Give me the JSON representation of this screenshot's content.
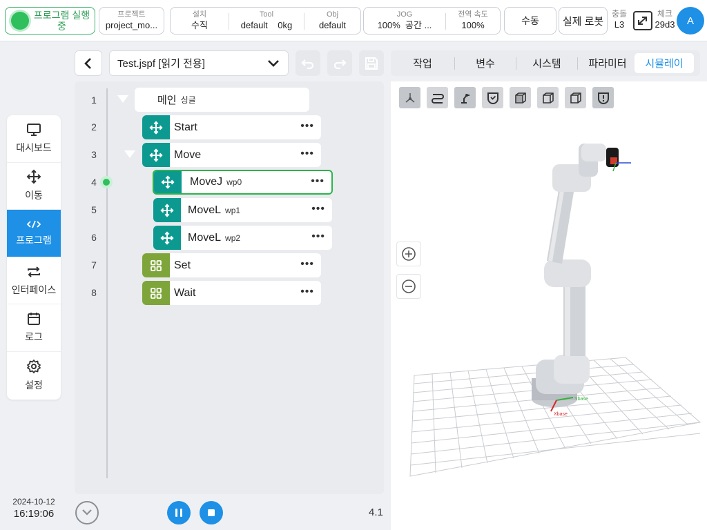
{
  "topbar": {
    "run_status": "프로그램 실행 중",
    "project": {
      "caption": "프로젝트",
      "value": "project_mo..."
    },
    "install": {
      "caption": "설치",
      "value": "수직"
    },
    "tool": {
      "caption": "Tool",
      "name": "default",
      "payload": "0kg"
    },
    "obj": {
      "caption": "Obj",
      "value": "default"
    },
    "jog": {
      "caption": "JOG",
      "speed": "100%",
      "frame": "공간 ..."
    },
    "global_speed": {
      "caption": "전역 속도",
      "value": "100%"
    },
    "mode_button": "수동",
    "robot_button": "실제 로봇",
    "collision": {
      "caption": "충돌",
      "value": "L3"
    },
    "check": {
      "caption": "체크",
      "value": "29d3"
    },
    "avatar": "A"
  },
  "nav": {
    "items": [
      {
        "label": "대시보드",
        "icon": "monitor-icon"
      },
      {
        "label": "이동",
        "icon": "move-icon"
      },
      {
        "label": "프로그램",
        "icon": "code-icon"
      },
      {
        "label": "인터페이스",
        "icon": "swap-icon"
      },
      {
        "label": "로그",
        "icon": "calendar-icon"
      },
      {
        "label": "설정",
        "icon": "gear-icon"
      }
    ],
    "active": 2
  },
  "datetime": {
    "date": "2024-10-12",
    "time": "16:19:06"
  },
  "program": {
    "file": "Test.jspf [읽기 전용]",
    "tree": [
      {
        "line": "1",
        "label": "메인",
        "sub": "싱글"
      },
      {
        "line": "2",
        "label": "Start",
        "sub": ""
      },
      {
        "line": "3",
        "label": "Move",
        "sub": ""
      },
      {
        "line": "4",
        "label": "MoveJ",
        "sub": "wp0"
      },
      {
        "line": "5",
        "label": "MoveL",
        "sub": "wp1"
      },
      {
        "line": "6",
        "label": "MoveL",
        "sub": "wp2"
      },
      {
        "line": "7",
        "label": "Set",
        "sub": ""
      },
      {
        "line": "8",
        "label": "Wait",
        "sub": ""
      }
    ],
    "current_line": "4",
    "version": "4.1"
  },
  "tabs": [
    "작업",
    "변수",
    "시스템",
    "파라미터",
    "시뮬레이"
  ],
  "active_tab": 4,
  "simulation": {
    "axis_labels": {
      "x": "Xbase",
      "y": "Ybase"
    },
    "toolbar_icons": [
      "axis-view-icon",
      "path-icon",
      "robot-arm-icon",
      "shield-check-icon",
      "cube-front-icon",
      "cube-side-icon",
      "cube-top-icon",
      "shield-alert-icon"
    ]
  },
  "colors": {
    "accent": "#1e90e6",
    "running": "#2fbf5c",
    "move_node": "#0c9a90",
    "io_node": "#7ea53a"
  }
}
